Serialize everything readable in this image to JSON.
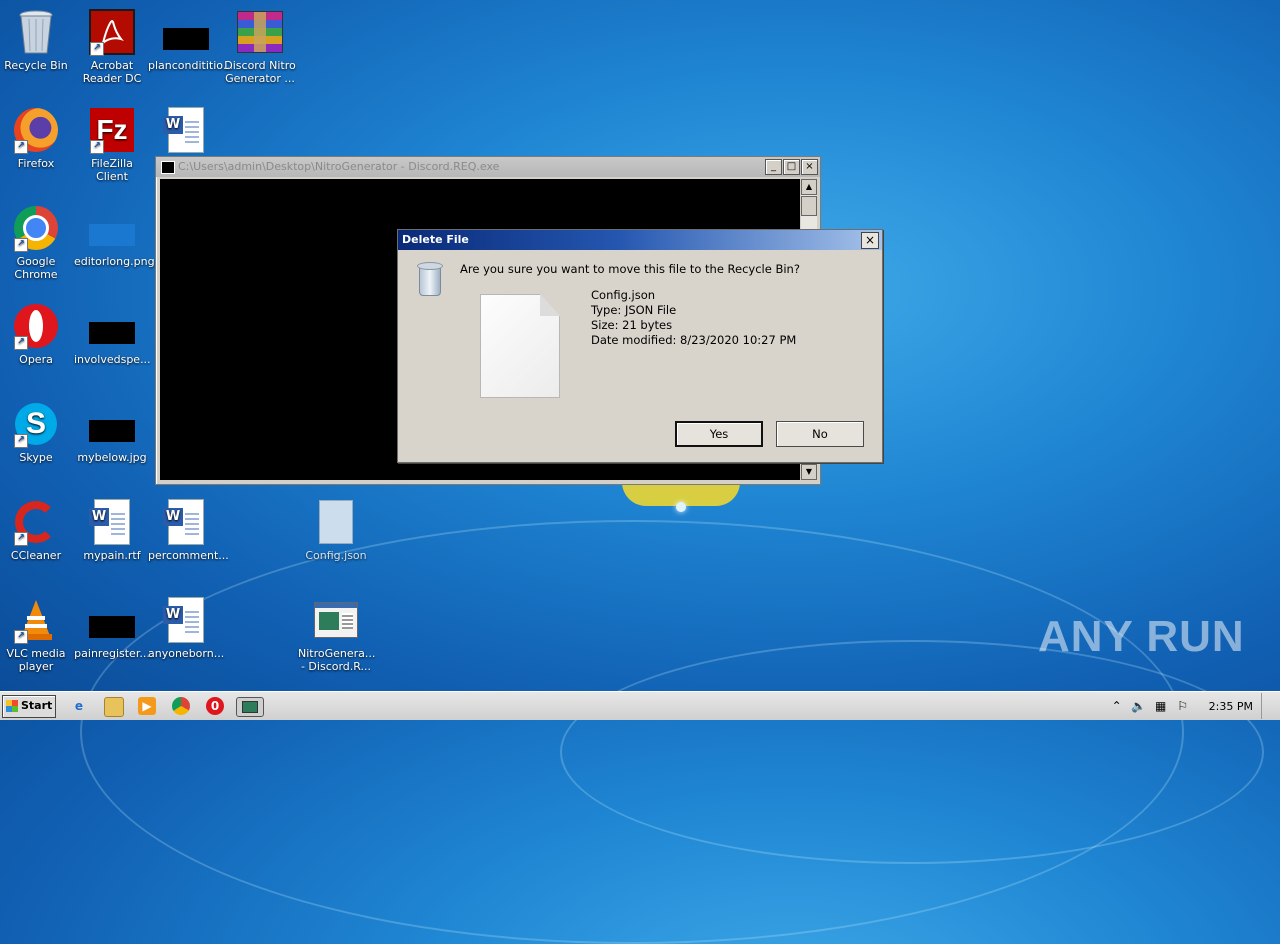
{
  "desktop": {
    "icons": [
      {
        "label": "Recycle Bin",
        "icon": "recycle-bin-icon"
      },
      {
        "label": "Acrobat\nReader DC",
        "icon": "acrobat-icon"
      },
      {
        "label": "plancondititio...",
        "icon": "black-thumbnail-icon"
      },
      {
        "label": "Discord Nitro\nGenerator ...",
        "icon": "winrar-archive-icon"
      },
      {
        "label": "Firefox",
        "icon": "firefox-icon"
      },
      {
        "label": "FileZilla Client",
        "icon": "filezilla-icon"
      },
      {
        "label": "Google\nChrome",
        "icon": "chrome-icon"
      },
      {
        "label": "editorlong.png",
        "icon": "image-file-icon"
      },
      {
        "label": "Opera",
        "icon": "opera-icon"
      },
      {
        "label": "involvedspe...",
        "icon": "black-thumbnail-icon"
      },
      {
        "label": "Skype",
        "icon": "skype-icon"
      },
      {
        "label": "mybelow.jpg",
        "icon": "black-thumbnail-icon"
      },
      {
        "label": "CCleaner",
        "icon": "ccleaner-icon"
      },
      {
        "label": "mypain.rtf",
        "icon": "word-document-icon"
      },
      {
        "label": "percomment...",
        "icon": "word-document-icon"
      },
      {
        "label": "Config.json",
        "icon": "blank-file-icon"
      },
      {
        "label": "VLC media\nplayer",
        "icon": "vlc-icon"
      },
      {
        "label": "painregister...",
        "icon": "black-thumbnail-icon"
      },
      {
        "label": "anyoneborn...",
        "icon": "word-document-icon"
      },
      {
        "label": "NitroGenera...\n- Discord.R...",
        "icon": "executable-icon"
      }
    ]
  },
  "console": {
    "title": "C:\\Users\\admin\\Desktop\\NitroGenerator - Discord.REQ.exe",
    "minimize": "_",
    "maximize": "□",
    "close": "×"
  },
  "dialog": {
    "title": "Delete File",
    "close": "×",
    "question": "Are you sure you want to move this file to the Recycle Bin?",
    "file_name": "Config.json",
    "file_type": "Type: JSON File",
    "file_size": "Size: 21 bytes",
    "file_modified": "Date modified: 8/23/2020 10:27 PM",
    "yes_label": "Yes",
    "no_label": "No"
  },
  "taskbar": {
    "start_label": "Start",
    "clock": "2:35 PM",
    "quick_launch": [
      "internet-explorer-icon",
      "explorer-folder-icon",
      "media-player-icon",
      "chrome-icon",
      "opera-icon",
      "console-window-icon"
    ]
  },
  "watermark": "ANY RUN"
}
